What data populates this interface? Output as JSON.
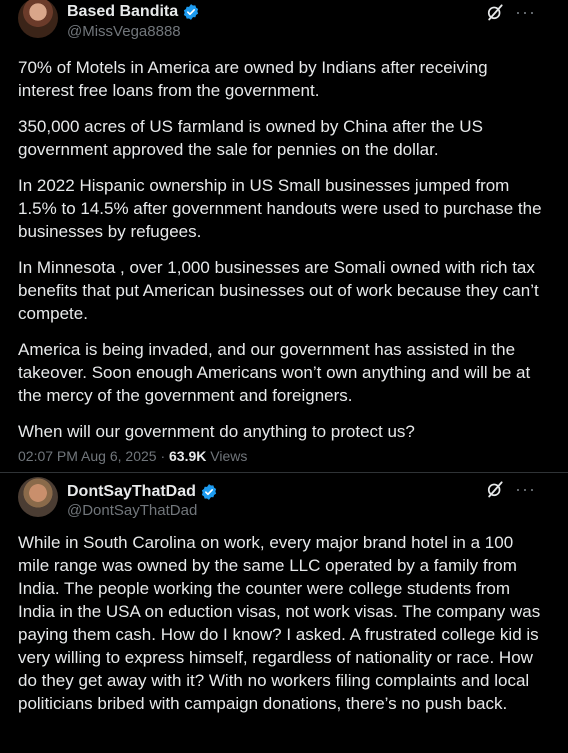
{
  "tweet1": {
    "display_name": "Based Bandita",
    "handle": "@MissVega8888",
    "paragraphs": [
      "70% of Motels in America are owned by Indians after receiving interest free loans from the government.",
      "350,000 acres of US farmland is owned by China after the US government approved the sale for pennies on the dollar.",
      "In 2022 Hispanic ownership in US Small businesses jumped from 1.5% to 14.5% after government handouts were used to purchase the businesses by refugees.",
      "In Minnesota , over 1,000 businesses are Somali owned with rich tax benefits that put American businesses out of work because they can’t compete.",
      "America is being invaded, and our government has assisted in the takeover.  Soon enough Americans won’t own anything and will be at the mercy of the government and foreigners.",
      "When will our government do anything to protect us?"
    ],
    "timestamp": "02:07 PM Aug 6, 2025",
    "separator": "·",
    "views_count": "63.9K",
    "views_label": "Views",
    "icons": {
      "verified": "verified-badge-icon",
      "grok": "grok-icon",
      "more": "more-icon"
    }
  },
  "tweet2": {
    "display_name": "DontSayThatDad",
    "handle": "@DontSayThatDad",
    "paragraphs": [
      "While in South Carolina on work, every major brand hotel in a 100 mile range was owned by the same LLC operated by a family from India. The people working the counter were college students from India in the USA on eduction visas, not work visas. The company was paying them cash. How do I know? I asked. A frustrated college kid is very willing to express himself, regardless of nationality or race. How do they get away with it? With no workers filing complaints and local politicians bribed with campaign donations, there’s no push back."
    ],
    "icons": {
      "verified": "verified-badge-icon",
      "grok": "grok-icon",
      "more": "more-icon"
    }
  },
  "colors": {
    "background": "#000000",
    "text": "#e7e9ea",
    "muted": "#71767b",
    "verified": "#1d9bf0",
    "divider": "#2f3336"
  },
  "more_glyph": "···"
}
